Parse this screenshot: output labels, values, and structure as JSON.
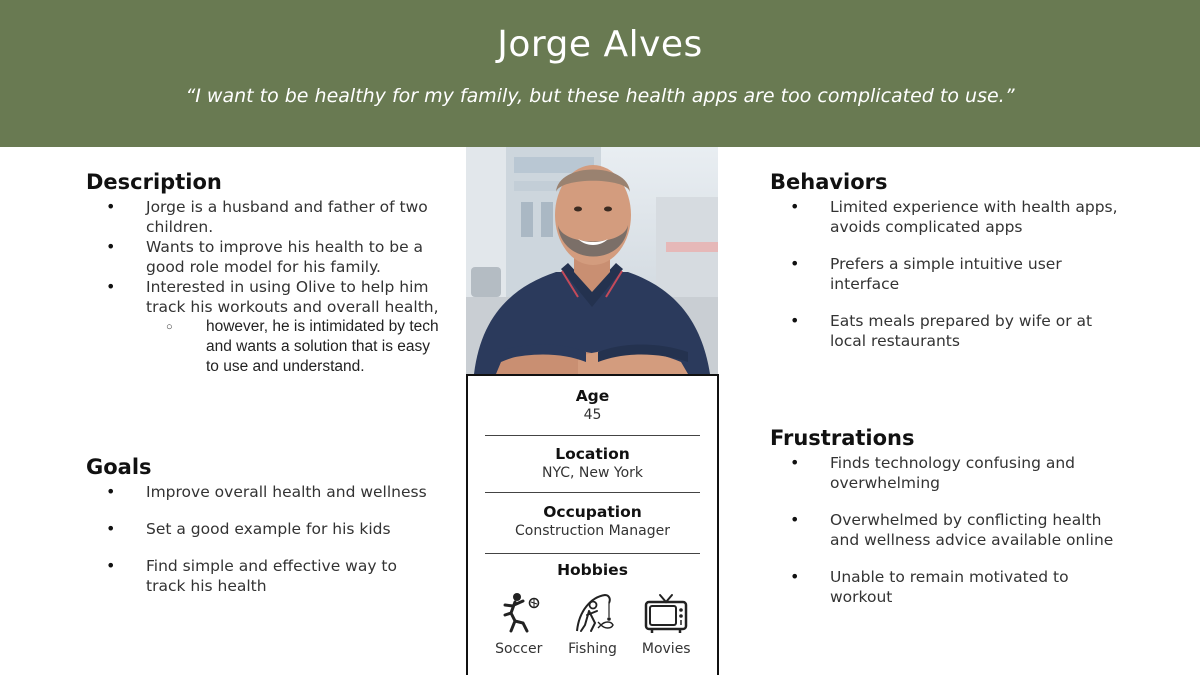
{
  "persona": {
    "name": "Jorge Alves",
    "quote": "“I want to be healthy for my family, but these health apps are too complicated to use.”"
  },
  "description": {
    "title": "Description",
    "items": [
      "Jorge is a husband and father of two children.",
      "Wants to improve his health to be a good role model for his family.",
      "Interested in using Olive to help him track his workouts and overall health,"
    ],
    "subitems": [
      "however, he is intimidated by tech and wants a solution that is easy to use and understand."
    ]
  },
  "goals": {
    "title": "Goals",
    "items": [
      "Improve overall health and wellness",
      "Set a good example for his kids",
      "Find simple and effective way to track his health"
    ]
  },
  "behaviors": {
    "title": "Behaviors",
    "items": [
      "Limited experience with health apps, avoids complicated apps",
      "Prefers a simple intuitive user interface",
      "Eats meals prepared by wife or at local restaurants"
    ]
  },
  "frustrations": {
    "title": "Frustrations",
    "items": [
      "Finds technology confusing and overwhelming",
      "Overwhelmed by conflicting health and wellness advice available online",
      "Unable to remain motivated to workout"
    ]
  },
  "card": {
    "age_label": "Age",
    "age_value": "45",
    "location_label": "Location",
    "location_value": "NYC, New York",
    "occupation_label": "Occupation",
    "occupation_value": "Construction Manager",
    "hobbies_label": "Hobbies",
    "hobbies": [
      {
        "label": "Soccer",
        "icon": "soccer-icon"
      },
      {
        "label": "Fishing",
        "icon": "fishing-icon"
      },
      {
        "label": "Movies",
        "icon": "tv-icon"
      }
    ]
  },
  "colors": {
    "header_bg": "#697a52",
    "shirt": "#2b3a5c"
  }
}
